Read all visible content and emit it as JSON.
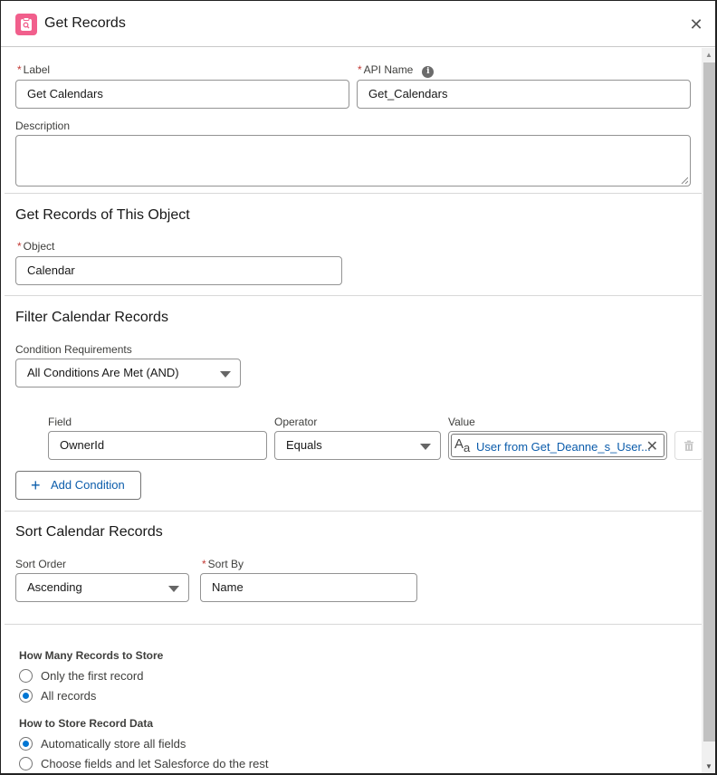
{
  "header": {
    "title": "Get Records",
    "icon": "get-records-icon",
    "close_icon": "close-icon"
  },
  "basics": {
    "label_label": "Label",
    "label_value": "Get Calendars",
    "api_name_label": "API Name",
    "api_name_value": "Get_Calendars",
    "description_label": "Description",
    "description_value": ""
  },
  "object_section": {
    "title": "Get Records of This Object",
    "object_label": "Object",
    "object_value": "Calendar"
  },
  "filter_section": {
    "title": "Filter Calendar Records",
    "condition_requirements_label": "Condition Requirements",
    "condition_requirements_value": "All Conditions Are Met (AND)",
    "conditions": [
      {
        "field_label": "Field",
        "field_value": "OwnerId",
        "operator_label": "Operator",
        "operator_value": "Equals",
        "value_label": "Value",
        "value_value": "User from Get_Deanne_s_User..."
      }
    ],
    "add_condition_label": "Add Condition"
  },
  "sort_section": {
    "title": "Sort Calendar Records",
    "sort_order_label": "Sort Order",
    "sort_order_value": "Ascending",
    "sort_by_label": "Sort By",
    "sort_by_value": "Name"
  },
  "store_section": {
    "how_many_label": "How Many Records to Store",
    "how_many_options": [
      {
        "label": "Only the first record",
        "selected": false
      },
      {
        "label": "All records",
        "selected": true
      }
    ],
    "how_store_label": "How to Store Record Data",
    "how_store_options": [
      {
        "label": "Automatically store all fields",
        "selected": true
      },
      {
        "label": "Choose fields and let Salesforce do the rest",
        "selected": false
      }
    ]
  },
  "colors": {
    "brand_icon": "#f15f8c",
    "link_blue": "#0b5cab",
    "radio_selected": "#0176d3",
    "required_red": "#c23934"
  }
}
